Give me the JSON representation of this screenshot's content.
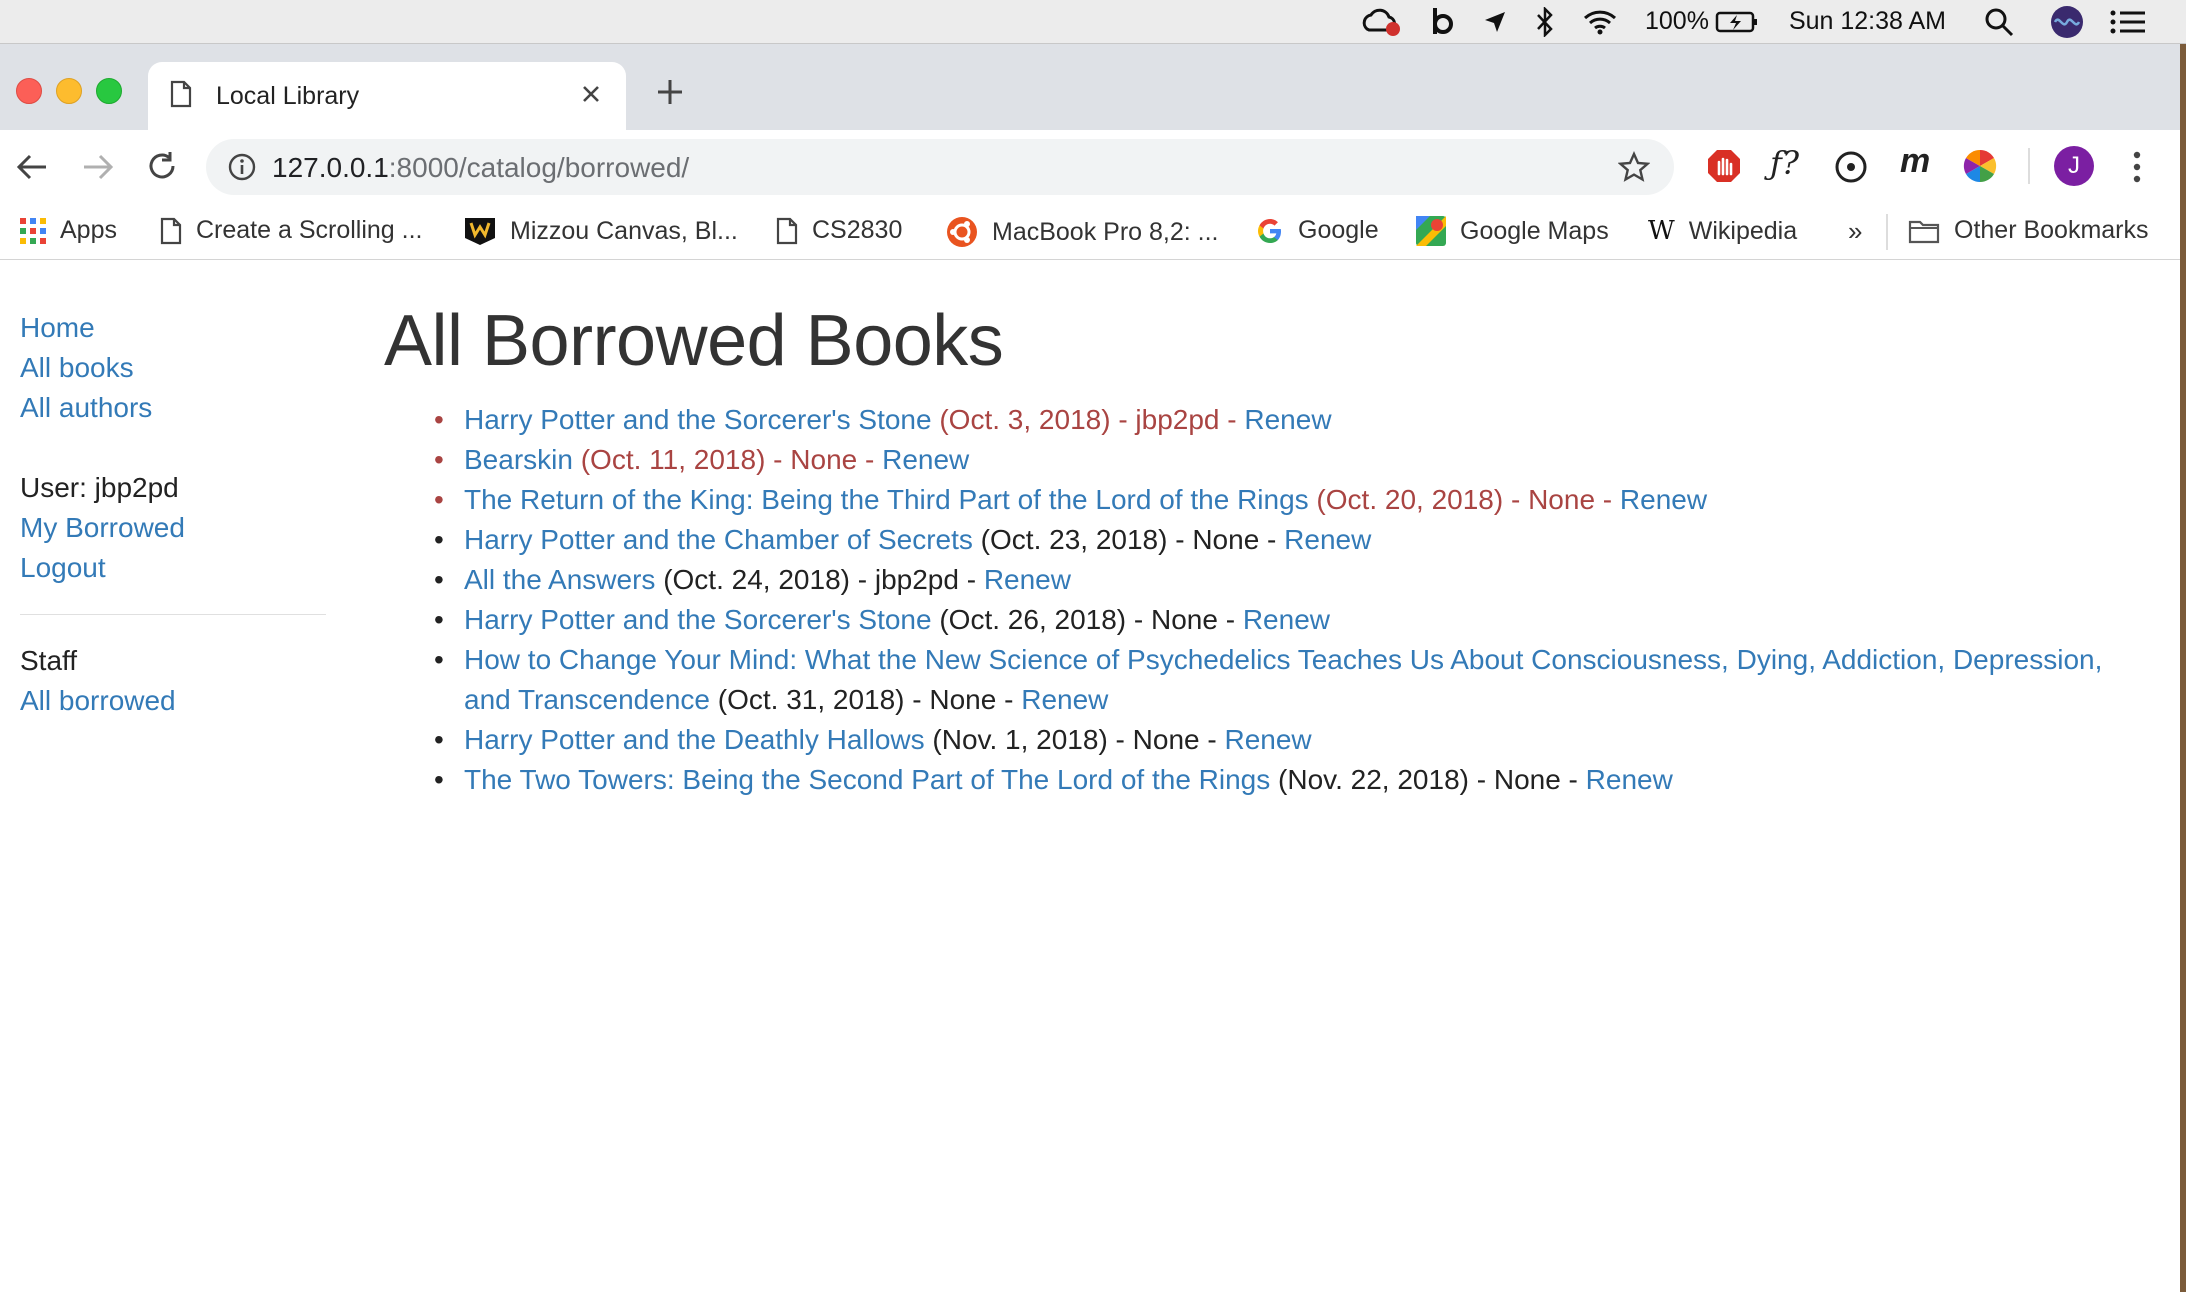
{
  "menubar": {
    "battery": "100%",
    "clock": "Sun 12:38 AM"
  },
  "browser": {
    "tab_title": "Local Library",
    "url_host": "127.0.0.1",
    "url_rest": ":8000/catalog/borrowed/",
    "profile_initial": "J"
  },
  "bookmarks": [
    {
      "label": "Apps",
      "icon": "apps-grid-icon"
    },
    {
      "label": "Create a Scrolling ...",
      "icon": "page-icon"
    },
    {
      "label": "Mizzou Canvas, Bl...",
      "icon": "mizzou-logo-icon"
    },
    {
      "label": "CS2830",
      "icon": "page-icon"
    },
    {
      "label": "MacBook Pro 8,2: ...",
      "icon": "ubuntu-icon"
    },
    {
      "label": "Google",
      "icon": "google-g-icon"
    },
    {
      "label": "Google Maps",
      "icon": "google-maps-icon"
    },
    {
      "label": "Wikipedia",
      "icon": "wikipedia-w-icon"
    }
  ],
  "bookmarks_overflow": "»",
  "other_bookmarks": "Other Bookmarks",
  "sidebar": {
    "home": "Home",
    "all_books": "All books",
    "all_authors": "All authors",
    "user": "User: jbp2pd",
    "my_borrowed": "My Borrowed",
    "logout": "Logout",
    "staff": "Staff",
    "all_borrowed": "All borrowed"
  },
  "main": {
    "title": "All Borrowed Books",
    "books": [
      {
        "title": "Harry Potter and the Sorcerer's Stone",
        "info": " (Oct. 3, 2018) - jbp2pd - ",
        "renew": "Renew",
        "overdue": true
      },
      {
        "title": "Bearskin",
        "info": " (Oct. 11, 2018) - None - ",
        "renew": "Renew",
        "overdue": true
      },
      {
        "title": "The Return of the King: Being the Third Part of the Lord of the Rings",
        "info": " (Oct. 20, 2018) - None - ",
        "renew": "Renew",
        "overdue": true
      },
      {
        "title": "Harry Potter and the Chamber of Secrets",
        "info": " (Oct. 23, 2018) - None - ",
        "renew": "Renew",
        "overdue": false
      },
      {
        "title": "All the Answers",
        "info": " (Oct. 24, 2018) - jbp2pd - ",
        "renew": "Renew",
        "overdue": false
      },
      {
        "title": "Harry Potter and the Sorcerer's Stone",
        "info": " (Oct. 26, 2018) - None - ",
        "renew": "Renew",
        "overdue": false
      },
      {
        "title": "How to Change Your Mind: What the New Science of Psychedelics Teaches Us About Consciousness, Dying, Addiction, Depression, and Transcendence",
        "info": " (Oct. 31, 2018) - None - ",
        "renew": "Renew",
        "overdue": false
      },
      {
        "title": "Harry Potter and the Deathly Hallows",
        "info": " (Nov. 1, 2018) - None - ",
        "renew": "Renew",
        "overdue": false
      },
      {
        "title": "The Two Towers: Being the Second Part of The Lord of the Rings",
        "info": " (Nov. 22, 2018) - None - ",
        "renew": "Renew",
        "overdue": false
      }
    ]
  },
  "colors": {
    "link": "#337ab7",
    "overdue": "#a94442",
    "text": "#222222"
  }
}
